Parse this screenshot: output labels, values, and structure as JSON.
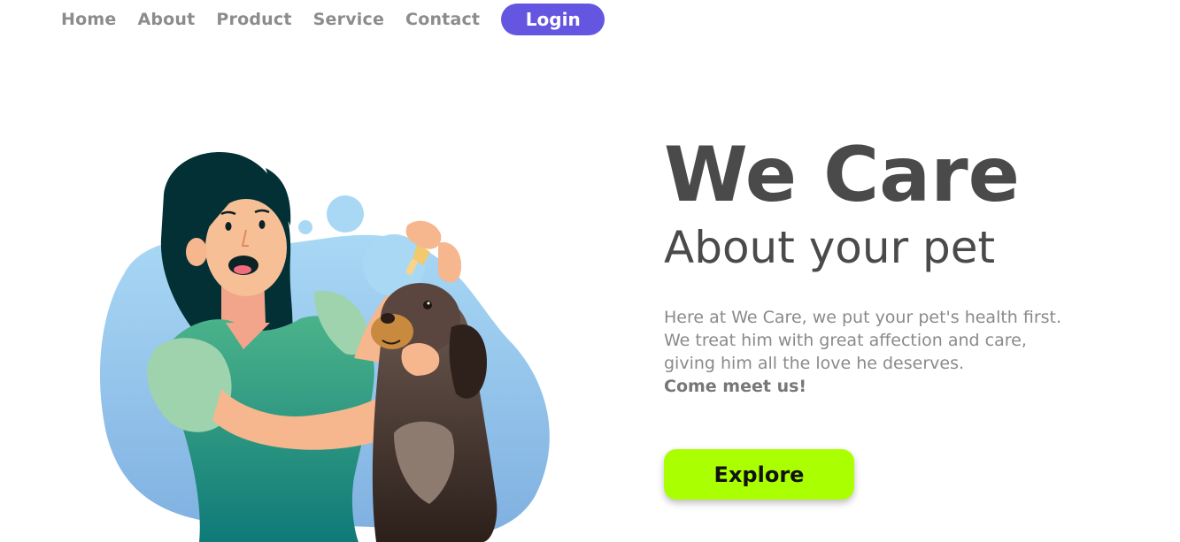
{
  "nav": {
    "items": [
      {
        "label": "Home"
      },
      {
        "label": "About"
      },
      {
        "label": "Product"
      },
      {
        "label": "Service"
      },
      {
        "label": "Contact"
      }
    ],
    "login_label": "Login"
  },
  "hero": {
    "title": "We Care",
    "subtitle": "About your pet",
    "description": "Here at We Care, we put your pet's health first. We treat him with great affection and care, giving him all the love he deserves.",
    "cta_text": "Come meet us!",
    "explore_label": "Explore"
  },
  "colors": {
    "accent": "#6456e1",
    "explore": "#aaff00",
    "heading": "#4a4a4a",
    "nav_text": "#8c8c8c"
  },
  "illustration": {
    "icon": "woman-with-dog-illustration"
  }
}
